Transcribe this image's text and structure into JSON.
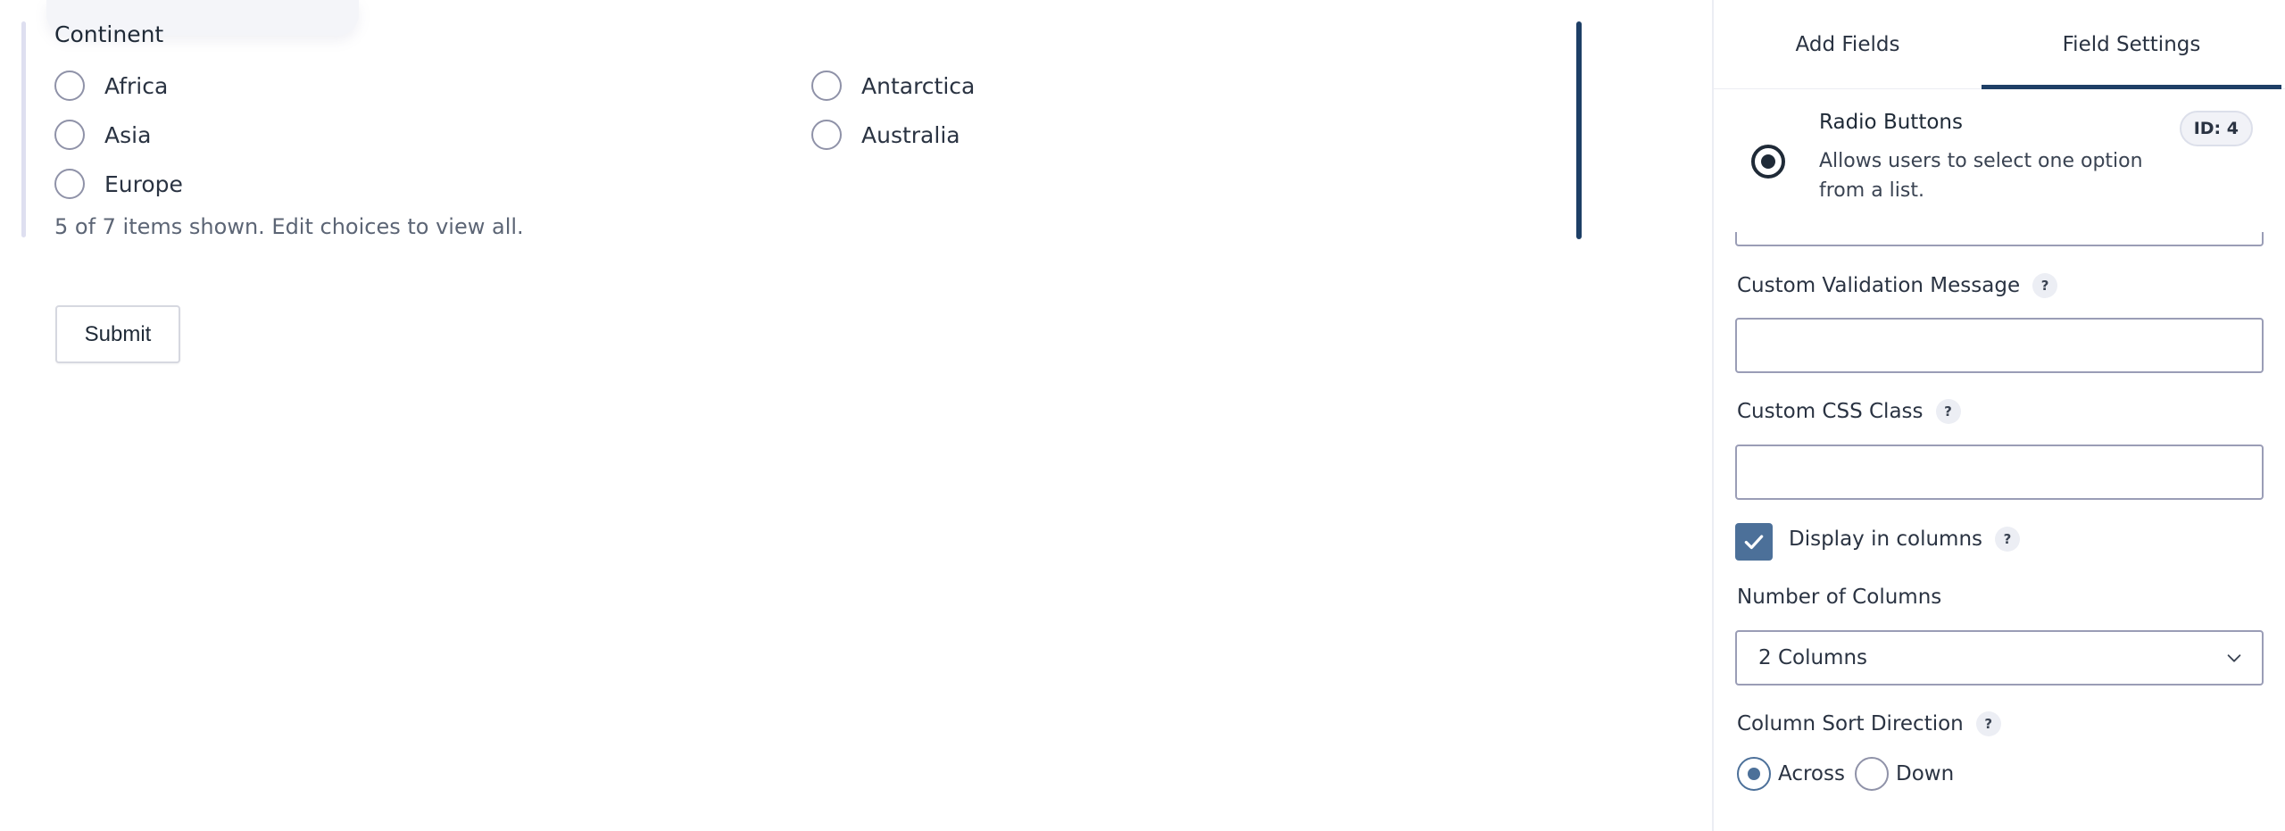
{
  "canvas": {
    "field": {
      "label": "Continent",
      "choices": [
        "Africa",
        "Antarctica",
        "Asia",
        "Australia",
        "Europe"
      ],
      "note": "5 of 7 items shown. Edit choices to view all."
    },
    "submit_label": "Submit"
  },
  "sidebar": {
    "tabs": [
      "Add Fields",
      "Field Settings"
    ],
    "active_tab": "Field Settings",
    "field_type": {
      "title": "Radio Buttons",
      "description": "Allows users to select one option from a list.",
      "id_badge": "ID: 4",
      "icon": "radio-button-icon"
    },
    "settings": {
      "validation_message_label": "Custom Validation Message",
      "validation_message_value": "",
      "css_class_label": "Custom CSS Class",
      "css_class_value": "",
      "display_columns_label": "Display in columns",
      "display_columns_checked": true,
      "num_columns_label": "Number of Columns",
      "num_columns_value": "2 Columns",
      "sort_direction_label": "Column Sort Direction",
      "sort_options": [
        "Across",
        "Down"
      ],
      "sort_selected": "Across",
      "help_glyph": "?"
    }
  },
  "colors": {
    "accent": "#1e3f66",
    "checkbox": "#4c7099",
    "input_border": "#9a9db6"
  }
}
